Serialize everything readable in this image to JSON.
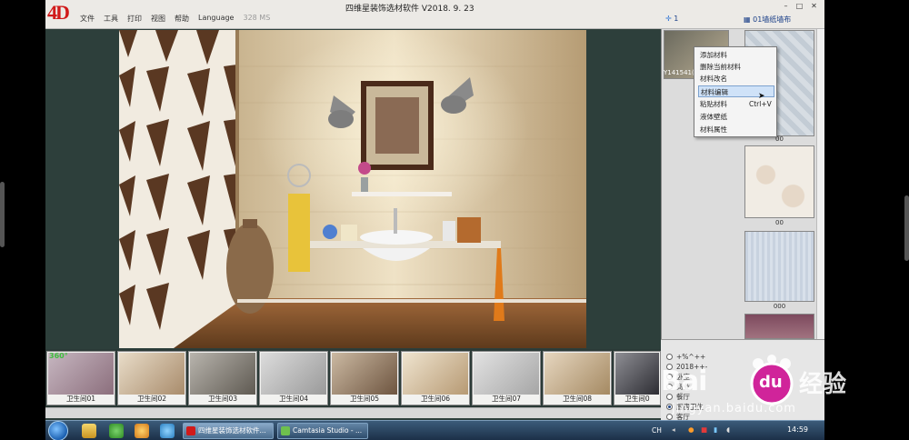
{
  "app": {
    "logo": "4D",
    "title": "四维星装饰选材软件  V2018. 9. 23",
    "menu": [
      "文件",
      "工具",
      "打印",
      "视图",
      "帮助",
      "Language"
    ],
    "timing": "328 MS",
    "layer_label": "1",
    "wall_label": "01墙纸墙布"
  },
  "materials": {
    "first_caption": "Y141541(",
    "items": [
      {
        "caption": "00"
      },
      {
        "caption": "00"
      },
      {
        "caption": "000"
      }
    ]
  },
  "context_menu": {
    "items": [
      {
        "label": "添加材料",
        "shortcut": ""
      },
      {
        "label": "删除当前材料",
        "shortcut": ""
      },
      {
        "label": "材料改名",
        "shortcut": ""
      },
      {
        "label": "材料编辑",
        "shortcut": "",
        "highlighted": true
      },
      {
        "label": "粘贴材料",
        "shortcut": "Ctrl+V"
      },
      {
        "label": "液体壁纸",
        "shortcut": ""
      },
      {
        "label": "材料属性",
        "shortcut": ""
      }
    ]
  },
  "tree": {
    "items": [
      {
        "label": "+%^++",
        "selected": false
      },
      {
        "label": "2018++-",
        "selected": false
      },
      {
        "label": "卧室",
        "selected": false
      },
      {
        "label": "商业",
        "selected": false
      },
      {
        "label": "餐厅",
        "selected": false
      },
      {
        "label": "厨房卫生",
        "selected": true
      },
      {
        "label": "客厅",
        "selected": false
      }
    ]
  },
  "scenes": {
    "badge": "360°",
    "items": [
      {
        "label": "卫生间01"
      },
      {
        "label": "卫生间02"
      },
      {
        "label": "卫生间03"
      },
      {
        "label": "卫生间04"
      },
      {
        "label": "卫生间05"
      },
      {
        "label": "卫生间06"
      },
      {
        "label": "卫生间07"
      },
      {
        "label": "卫生间08"
      },
      {
        "label": "卫生间0"
      }
    ]
  },
  "taskbar": {
    "tasks": [
      {
        "label": "四维星装饰选材软件...",
        "active": true
      },
      {
        "label": "Camtasia Studio - ...",
        "active": false
      }
    ],
    "tray_text": "CH",
    "clock": "14:59"
  },
  "watermark": {
    "brand": "Bai",
    "brand2": "经验",
    "url": "jingyan.baidu.com",
    "paw_text": "du"
  },
  "colors": {
    "accent": "#1a3f88",
    "logo_red": "#d11a1a",
    "menu_highlight": "#cfe2f8"
  }
}
